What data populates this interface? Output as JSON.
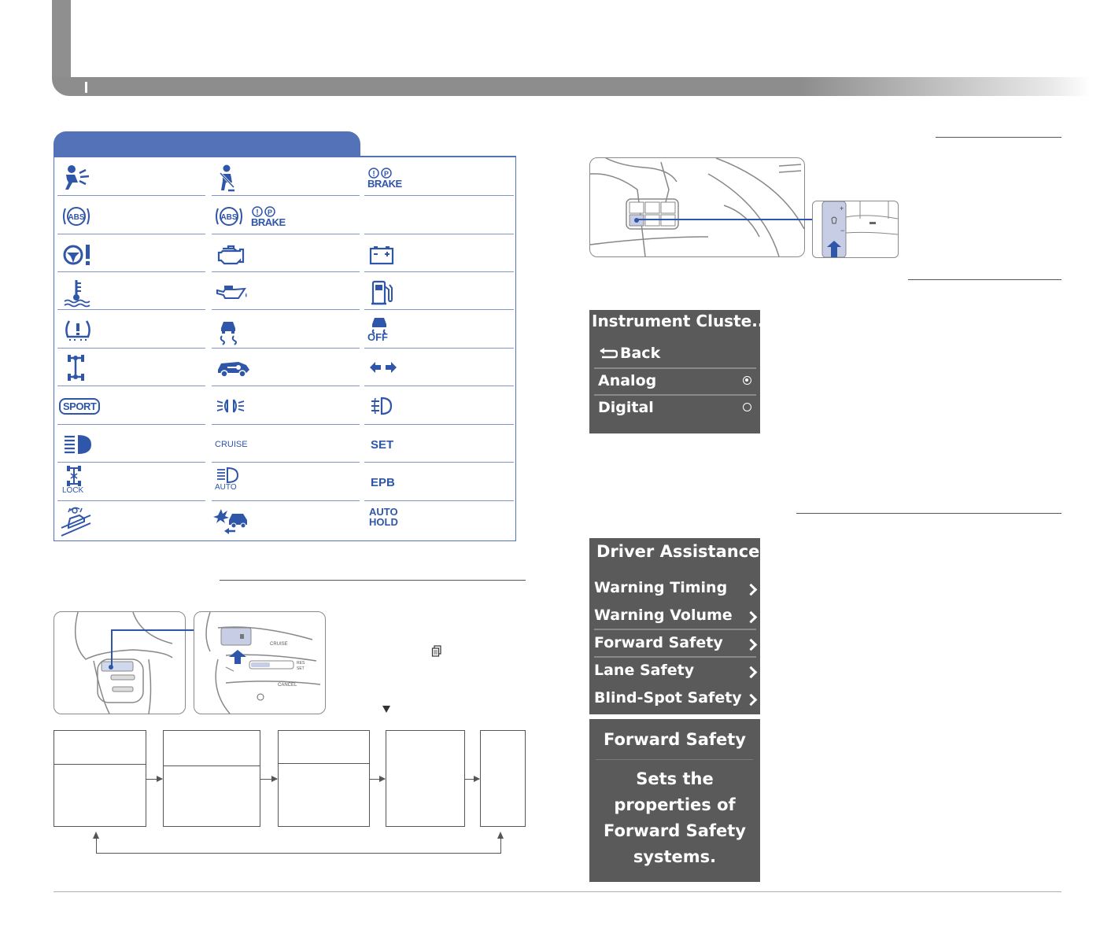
{
  "header": {
    "title": ""
  },
  "indicators": {
    "rows": [
      [
        {
          "icon": "airbag-warning-icon",
          "text": ""
        },
        {
          "icon": "seat-belt-warning-icon",
          "text": ""
        },
        {
          "icon": "parking-brake-warning-icon",
          "text": "(!)(P) BRAKE"
        }
      ],
      [
        {
          "icon": "abs-warning-icon",
          "text": "(ABS)"
        },
        {
          "icon": "ebd-warning-icon",
          "text": "(ABS) (!)(P) BRAKE"
        },
        {
          "icon": "empty",
          "text": ""
        }
      ],
      [
        {
          "icon": "power-steering-warning-icon",
          "text": ""
        },
        {
          "icon": "check-engine-icon",
          "text": ""
        },
        {
          "icon": "battery-warning-icon",
          "text": ""
        }
      ],
      [
        {
          "icon": "coolant-temperature-icon",
          "text": ""
        },
        {
          "icon": "oil-pressure-icon",
          "text": ""
        },
        {
          "icon": "low-fuel-icon",
          "text": ""
        }
      ],
      [
        {
          "icon": "tire-pressure-icon",
          "text": ""
        },
        {
          "icon": "esc-icon",
          "text": ""
        },
        {
          "icon": "esc-off-icon",
          "text": "OFF"
        }
      ],
      [
        {
          "icon": "awd-icon",
          "text": ""
        },
        {
          "icon": "immobilizer-key-icon",
          "text": ""
        },
        {
          "icon": "turn-signal-icon",
          "text": ""
        }
      ],
      [
        {
          "icon": "sport-mode-icon",
          "text": "SPORT"
        },
        {
          "icon": "position-lamp-icon",
          "text": ""
        },
        {
          "icon": "front-fog-lamp-icon",
          "text": ""
        }
      ],
      [
        {
          "icon": "high-beam-icon",
          "text": ""
        },
        {
          "icon": "cruise-icon",
          "text": "CRUISE"
        },
        {
          "icon": "set-icon",
          "text": "SET"
        }
      ],
      [
        {
          "icon": "awd-lock-icon",
          "text": "LOCK"
        },
        {
          "icon": "auto-high-beam-icon",
          "text": "AUTO"
        },
        {
          "icon": "epb-icon",
          "text": "EPB"
        }
      ],
      [
        {
          "icon": "downhill-brake-control-icon",
          "text": ""
        },
        {
          "icon": "forward-collision-icon",
          "text": ""
        },
        {
          "icon": "auto-hold-icon",
          "text": "AUTO HOLD"
        }
      ]
    ],
    "brake_label": "BRAKE",
    "abs_label": "ABS",
    "sport_label": "SPORT",
    "off_label": "OFF",
    "cruise_label": "CRUISE",
    "set_label": "SET",
    "lock_label": "LOCK",
    "auto_label": "AUTO",
    "epb_label": "EPB",
    "auto_hold_1": "AUTO",
    "auto_hold_2": "HOLD"
  },
  "steering": {
    "cruise_label": "CRUISE",
    "cancel_label": "CANCEL",
    "res_label": "RES",
    "set_label": "SET",
    "plus": "+",
    "minus": "−"
  },
  "right_illus": {
    "plus": "+",
    "minus": "−"
  },
  "cluster_menu": {
    "title": "Instrument Cluste...",
    "back": "Back",
    "options": [
      {
        "label": "Analog",
        "selected": true
      },
      {
        "label": "Digital",
        "selected": false
      }
    ]
  },
  "driver_assist": {
    "title": "Driver Assistance",
    "items": [
      "Warning Timing",
      "Warning Volume",
      "Forward Safety",
      "Lane Safety",
      "Blind-Spot Safety"
    ]
  },
  "forward_safety": {
    "title": "Forward Safety",
    "lines": [
      "Sets the",
      "properties of",
      "Forward Safety",
      "systems."
    ]
  },
  "colors": {
    "accent": "#5472b8",
    "icon": "#2f56a8",
    "screen": "#5a5a5a",
    "header_gray": "#8d8d8d"
  }
}
